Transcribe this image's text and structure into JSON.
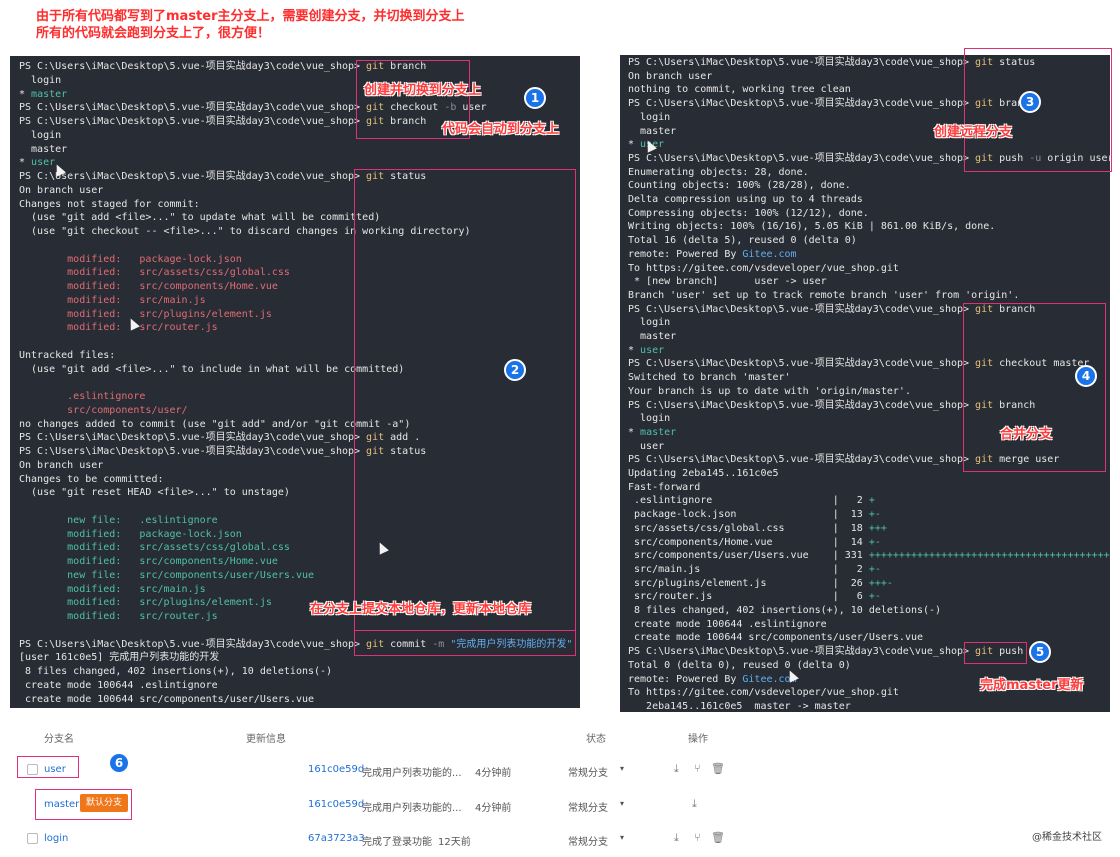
{
  "intro": [
    "由于所有代码都写到了master主分支上，需要创建分支，并切换到分支上",
    "所有的代码就会跑到分支上了，很方便！"
  ],
  "left_terminal": [
    [
      {
        "t": "PS C:\\Users\\iMac\\Desktop\\5.vue-项目实战day3\\code\\vue_shop> "
      },
      {
        "t": "git",
        "c": "git"
      },
      {
        "t": " branch"
      }
    ],
    [
      {
        "t": "  login"
      }
    ],
    [
      {
        "t": "* "
      },
      {
        "t": "master",
        "c": "green"
      }
    ],
    [
      {
        "t": "PS C:\\Users\\iMac\\Desktop\\5.vue-项目实战day3\\code\\vue_shop> "
      },
      {
        "t": "git",
        "c": "git"
      },
      {
        "t": " checkout "
      },
      {
        "t": "-b",
        "c": "flag"
      },
      {
        "t": " user"
      }
    ],
    [
      {
        "t": "PS C:\\Users\\iMac\\Desktop\\5.vue-项目实战day3\\code\\vue_shop> "
      },
      {
        "t": "git",
        "c": "git"
      },
      {
        "t": " branch"
      }
    ],
    [
      {
        "t": "  login"
      }
    ],
    [
      {
        "t": "  master"
      }
    ],
    [
      {
        "t": "* "
      },
      {
        "t": "user",
        "c": "green"
      }
    ],
    [
      {
        "t": "PS C:\\Users\\iMac\\Desktop\\5.vue-项目实战day3\\code\\vue_shop> "
      },
      {
        "t": "git",
        "c": "git"
      },
      {
        "t": " status"
      }
    ],
    [
      {
        "t": "On branch user"
      }
    ],
    [
      {
        "t": "Changes not staged for commit:"
      }
    ],
    [
      {
        "t": "  (use \"git add <file>...\" to update what will be committed)"
      }
    ],
    [
      {
        "t": "  (use \"git checkout -- <file>...\" to discard changes in working directory)"
      }
    ],
    [
      {
        "t": ""
      }
    ],
    [
      {
        "t": "        modified:   package-lock.json",
        "c": "red"
      }
    ],
    [
      {
        "t": "        modified:   src/assets/css/global.css",
        "c": "red"
      }
    ],
    [
      {
        "t": "        modified:   src/components/Home.vue",
        "c": "red"
      }
    ],
    [
      {
        "t": "        modified:   src/main.js",
        "c": "red"
      }
    ],
    [
      {
        "t": "        modified:   src/plugins/element.js",
        "c": "red"
      }
    ],
    [
      {
        "t": "        modified:   src/router.js",
        "c": "red"
      }
    ],
    [
      {
        "t": ""
      }
    ],
    [
      {
        "t": "Untracked files:"
      }
    ],
    [
      {
        "t": "  (use \"git add <file>...\" to include in what will be committed)"
      }
    ],
    [
      {
        "t": ""
      }
    ],
    [
      {
        "t": "        .eslintignore",
        "c": "red"
      }
    ],
    [
      {
        "t": "        src/components/user/",
        "c": "red"
      }
    ],
    [
      {
        "t": "no changes added to commit (use \"git add\" and/or \"git commit -a\")"
      }
    ],
    [
      {
        "t": "PS C:\\Users\\iMac\\Desktop\\5.vue-项目实战day3\\code\\vue_shop> "
      },
      {
        "t": "git",
        "c": "git"
      },
      {
        "t": " add ."
      }
    ],
    [
      {
        "t": "PS C:\\Users\\iMac\\Desktop\\5.vue-项目实战day3\\code\\vue_shop> "
      },
      {
        "t": "git",
        "c": "git"
      },
      {
        "t": " status"
      }
    ],
    [
      {
        "t": "On branch user"
      }
    ],
    [
      {
        "t": "Changes to be committed:"
      }
    ],
    [
      {
        "t": "  (use \"git reset HEAD <file>...\" to unstage)"
      }
    ],
    [
      {
        "t": ""
      }
    ],
    [
      {
        "t": "        new file:   .eslintignore",
        "c": "green"
      }
    ],
    [
      {
        "t": "        modified:   package-lock.json",
        "c": "green"
      }
    ],
    [
      {
        "t": "        modified:   src/assets/css/global.css",
        "c": "green"
      }
    ],
    [
      {
        "t": "        modified:   src/components/Home.vue",
        "c": "green"
      }
    ],
    [
      {
        "t": "        new file:   src/components/user/Users.vue",
        "c": "green"
      }
    ],
    [
      {
        "t": "        modified:   src/main.js",
        "c": "green"
      }
    ],
    [
      {
        "t": "        modified:   src/plugins/element.js",
        "c": "green"
      }
    ],
    [
      {
        "t": "        modified:   src/router.js",
        "c": "green"
      }
    ],
    [
      {
        "t": ""
      }
    ],
    [
      {
        "t": "PS C:\\Users\\iMac\\Desktop\\5.vue-项目实战day3\\code\\vue_shop> "
      },
      {
        "t": "git",
        "c": "git"
      },
      {
        "t": " commit "
      },
      {
        "t": "-m",
        "c": "flag"
      },
      {
        "t": " \"完成用户列表功能的开发\"",
        "c": "link"
      }
    ],
    [
      {
        "t": "[user 161c0e5] 完成用户列表功能的开发"
      }
    ],
    [
      {
        "t": " 8 files changed, 402 insertions(+), 10 deletions(-)"
      }
    ],
    [
      {
        "t": " create mode 100644 .eslintignore"
      }
    ],
    [
      {
        "t": " create mode 100644 src/components/user/Users.vue"
      }
    ]
  ],
  "right_terminal": [
    [
      {
        "t": "PS C:\\Users\\iMac\\Desktop\\5.vue-项目实战day3\\code\\vue_shop> "
      },
      {
        "t": "git",
        "c": "git"
      },
      {
        "t": " status"
      }
    ],
    [
      {
        "t": "On branch user"
      }
    ],
    [
      {
        "t": "nothing to commit, working tree clean"
      }
    ],
    [
      {
        "t": "PS C:\\Users\\iMac\\Desktop\\5.vue-项目实战day3\\code\\vue_shop> "
      },
      {
        "t": "git",
        "c": "git"
      },
      {
        "t": " branch"
      }
    ],
    [
      {
        "t": "  login"
      }
    ],
    [
      {
        "t": "  master"
      }
    ],
    [
      {
        "t": "* "
      },
      {
        "t": "user",
        "c": "green"
      }
    ],
    [
      {
        "t": "PS C:\\Users\\iMac\\Desktop\\5.vue-项目实战day3\\code\\vue_shop> "
      },
      {
        "t": "git",
        "c": "git"
      },
      {
        "t": " push "
      },
      {
        "t": "-u",
        "c": "flag"
      },
      {
        "t": " origin user"
      }
    ],
    [
      {
        "t": "Enumerating objects: 28, done."
      }
    ],
    [
      {
        "t": "Counting objects: 100% (28/28), done."
      }
    ],
    [
      {
        "t": "Delta compression using up to 4 threads"
      }
    ],
    [
      {
        "t": "Compressing objects: 100% (12/12), done."
      }
    ],
    [
      {
        "t": "Writing objects: 100% (16/16), 5.05 KiB | 861.00 KiB/s, done."
      }
    ],
    [
      {
        "t": "Total 16 (delta 5), reused 0 (delta 0)"
      }
    ],
    [
      {
        "t": "remote: Powered By "
      },
      {
        "t": "Gitee.com",
        "c": "link"
      }
    ],
    [
      {
        "t": "To https://gitee.com/vsdeveloper/vue_shop.git"
      }
    ],
    [
      {
        "t": " * [new branch]      user -> user"
      }
    ],
    [
      {
        "t": "Branch 'user' set up to track remote branch 'user' from 'origin'."
      }
    ],
    [
      {
        "t": "PS C:\\Users\\iMac\\Desktop\\5.vue-项目实战day3\\code\\vue_shop> "
      },
      {
        "t": "git",
        "c": "git"
      },
      {
        "t": " branch"
      }
    ],
    [
      {
        "t": "  login"
      }
    ],
    [
      {
        "t": "  master"
      }
    ],
    [
      {
        "t": "* "
      },
      {
        "t": "user",
        "c": "green"
      }
    ],
    [
      {
        "t": "PS C:\\Users\\iMac\\Desktop\\5.vue-项目实战day3\\code\\vue_shop> "
      },
      {
        "t": "git",
        "c": "git"
      },
      {
        "t": " checkout master"
      }
    ],
    [
      {
        "t": "Switched to branch 'master'"
      }
    ],
    [
      {
        "t": "Your branch is up to date with 'origin/master'."
      }
    ],
    [
      {
        "t": "PS C:\\Users\\iMac\\Desktop\\5.vue-项目实战day3\\code\\vue_shop> "
      },
      {
        "t": "git",
        "c": "git"
      },
      {
        "t": " branch"
      }
    ],
    [
      {
        "t": "  login"
      }
    ],
    [
      {
        "t": "* "
      },
      {
        "t": "master",
        "c": "green"
      }
    ],
    [
      {
        "t": "  user"
      }
    ],
    [
      {
        "t": "PS C:\\Users\\iMac\\Desktop\\5.vue-项目实战day3\\code\\vue_shop> "
      },
      {
        "t": "git",
        "c": "git"
      },
      {
        "t": " merge user"
      }
    ],
    [
      {
        "t": "Updating 2eba145..161c0e5"
      }
    ],
    [
      {
        "t": "Fast-forward"
      }
    ],
    [
      {
        "t": " .eslintignore                    |   2 "
      },
      {
        "t": "+",
        "c": "green"
      }
    ],
    [
      {
        "t": " package-lock.json                |  13 "
      },
      {
        "t": "+-",
        "c": "green"
      }
    ],
    [
      {
        "t": " src/assets/css/global.css        |  18 "
      },
      {
        "t": "+++",
        "c": "green"
      }
    ],
    [
      {
        "t": " src/components/Home.vue          |  14 "
      },
      {
        "t": "+-",
        "c": "green"
      }
    ],
    [
      {
        "t": " src/components/user/Users.vue    | 331 "
      },
      {
        "t": "++++++++++++++++++++++++++++++++++++++++",
        "c": "green"
      }
    ],
    [
      {
        "t": " src/main.js                      |   2 "
      },
      {
        "t": "+-",
        "c": "green"
      }
    ],
    [
      {
        "t": " src/plugins/element.js           |  26 "
      },
      {
        "t": "+++-",
        "c": "green"
      }
    ],
    [
      {
        "t": " src/router.js                    |   6 "
      },
      {
        "t": "+-",
        "c": "green"
      }
    ],
    [
      {
        "t": " 8 files changed, 402 insertions(+), 10 deletions(-)"
      }
    ],
    [
      {
        "t": " create mode 100644 .eslintignore"
      }
    ],
    [
      {
        "t": " create mode 100644 src/components/user/Users.vue"
      }
    ],
    [
      {
        "t": "PS C:\\Users\\iMac\\Desktop\\5.vue-项目实战day3\\code\\vue_shop> "
      },
      {
        "t": "git",
        "c": "git"
      },
      {
        "t": " push"
      }
    ],
    [
      {
        "t": "Total 0 (delta 0), reused 0 (delta 0)"
      }
    ],
    [
      {
        "t": "remote: Powered By "
      },
      {
        "t": "Gitee.com",
        "c": "link"
      }
    ],
    [
      {
        "t": "To https://gitee.com/vsdeveloper/vue_shop.git"
      }
    ],
    [
      {
        "t": "   2eba145..161c0e5  master -> master"
      }
    ]
  ],
  "annotations": {
    "n1": "1",
    "n2": "2",
    "n3": "3",
    "n4": "4",
    "n5": "5",
    "n6": "6",
    "create_switch": "创建并切换到分支上",
    "auto_to_branch": "代码会自动到分支上",
    "commit_local": "在分支上提交本地仓库，更新本地仓库",
    "create_remote": "创建远程分支",
    "merge": "合并分支",
    "push_master": "完成master更新"
  },
  "branch_table": {
    "headers": {
      "name": "分支名",
      "update": "更新信息",
      "status": "状态",
      "actions": "操作"
    },
    "rows": [
      {
        "name": "user",
        "hash": "161c0e59d",
        "msg": "完成用户列表功能的...",
        "time": "4分钟前",
        "status": "常规分支",
        "badge": ""
      },
      {
        "name": "master",
        "hash": "161c0e59d",
        "msg": "完成用户列表功能的...",
        "time": "4分钟前",
        "status": "常规分支",
        "badge": "默认分支"
      },
      {
        "name": "login",
        "hash": "67a3723a3",
        "msg": "完成了登录功能",
        "time": "12天前",
        "status": "常规分支",
        "badge": ""
      }
    ],
    "icons": {
      "download": "download-icon",
      "merge": "merge-icon",
      "delete": "delete-icon",
      "dropdown": "dropdown-caret-icon"
    }
  },
  "watermark": "@稀金技术社区"
}
